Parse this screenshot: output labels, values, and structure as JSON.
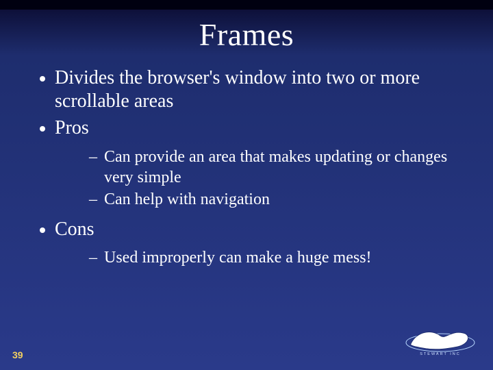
{
  "title": "Frames",
  "bullets": [
    {
      "text": "Divides the browser's window into two or more scrollable areas"
    },
    {
      "text": "Pros",
      "sub": [
        "Can provide an area that makes updating or changes very simple",
        "Can help with navigation"
      ]
    },
    {
      "text": "Cons",
      "sub": [
        "Used improperly can make a huge mess!"
      ]
    }
  ],
  "page_number": "39",
  "logo_caption": "STEWART INC"
}
